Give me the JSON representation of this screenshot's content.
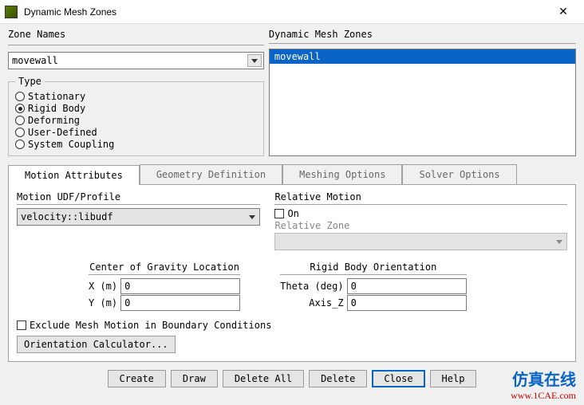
{
  "window": {
    "title": "Dynamic Mesh Zones"
  },
  "zone_names": {
    "label": "Zone Names",
    "value": "movewall"
  },
  "dynamic_mesh_zones": {
    "label": "Dynamic Mesh Zones",
    "items": [
      "movewall"
    ],
    "selected_index": 0
  },
  "type": {
    "label": "Type",
    "options": [
      "Stationary",
      "Rigid Body",
      "Deforming",
      "User-Defined",
      "System Coupling"
    ],
    "selected": "Rigid Body"
  },
  "tabs": {
    "items": [
      "Motion Attributes",
      "Geometry Definition",
      "Meshing Options",
      "Solver Options"
    ],
    "active_index": 0
  },
  "motion_udf": {
    "label": "Motion UDF/Profile",
    "value": "velocity::libudf"
  },
  "relative_motion": {
    "label": "Relative Motion",
    "on_label": "On",
    "on_checked": false,
    "relative_zone_label": "Relative Zone",
    "relative_zone_value": ""
  },
  "center_of_gravity": {
    "label": "Center of Gravity Location",
    "x_label": "X (m)",
    "y_label": "Y (m)",
    "x": "0",
    "y": "0"
  },
  "rigid_body_orientation": {
    "label": "Rigid Body Orientation",
    "theta_label": "Theta (deg)",
    "axis_z_label": "Axis_Z",
    "theta": "0",
    "axis_z": "0"
  },
  "exclude": {
    "label": "Exclude Mesh Motion in Boundary Conditions",
    "checked": false
  },
  "orientation_calculator": {
    "label": "Orientation Calculator..."
  },
  "buttons": {
    "create": "Create",
    "draw": "Draw",
    "delete_all": "Delete All",
    "delete": "Delete",
    "close": "Close",
    "help": "Help"
  },
  "watermark": {
    "cn": "仿真在线",
    "url": "www.1CAE.com"
  }
}
